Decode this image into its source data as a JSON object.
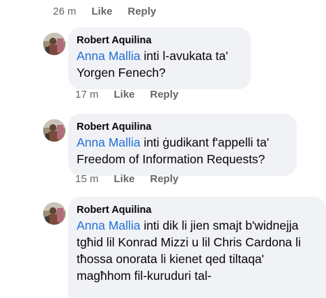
{
  "top_comment_actions": {
    "time": "26 m",
    "like": "Like",
    "reply": "Reply"
  },
  "comments": [
    {
      "author": "Robert Aquilina",
      "mention": "Anna Mallia",
      "text": " inti l-avukata ta' Yorgen Fenech?",
      "time": "17 m",
      "like": "Like",
      "reply": "Reply"
    },
    {
      "author": "Robert Aquilina",
      "mention": "Anna Mallia",
      "text": " inti ġudikant f'appelli ta' Freedom of Information Requests?",
      "time": "15 m",
      "like": "Like",
      "reply": "Reply"
    },
    {
      "author": "Robert Aquilina",
      "mention": "Anna Mallia",
      "text": " inti dik li jien smajt b'widnejja tgħid lil Konrad Mizzi u lil Chris Cardona li tħossa onorata li kienet qed tiltaqa' magħhom fil-kuruduri tal-"
    }
  ],
  "colors": {
    "bubble": "#f0f2f5",
    "mention": "#216fdb",
    "meta": "#65676b",
    "text": "#050505"
  }
}
